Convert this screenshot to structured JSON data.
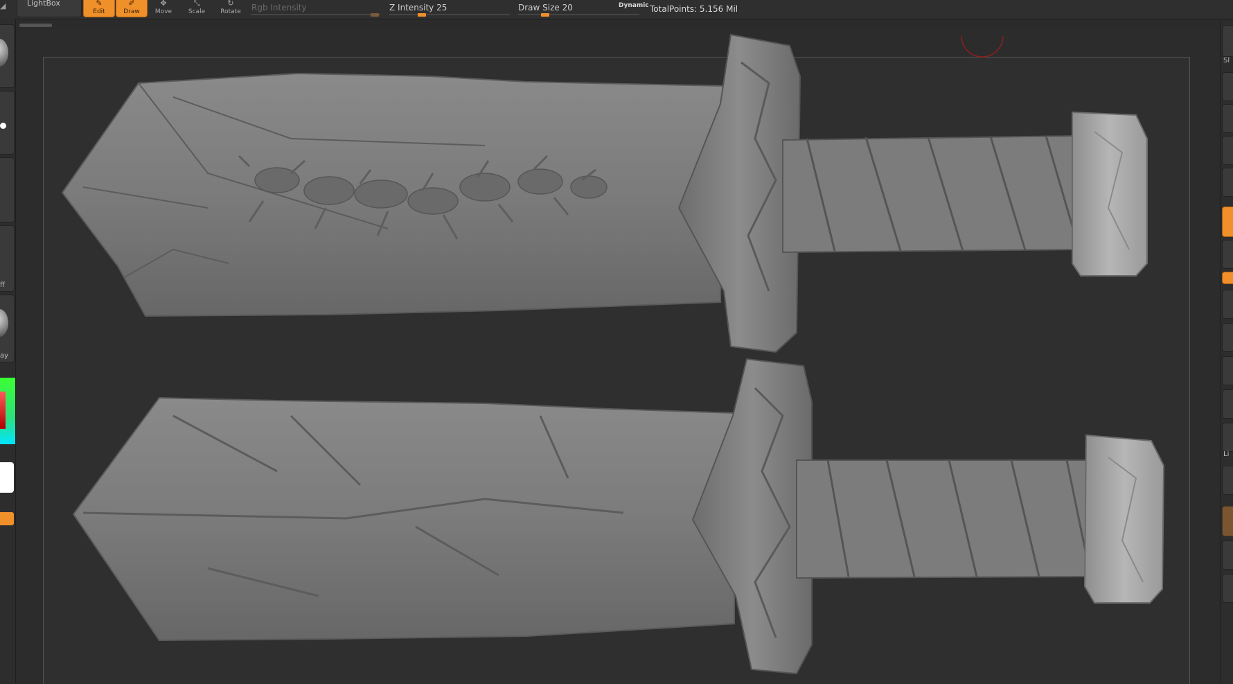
{
  "toolbar": {
    "lightbox_label": "LightBox",
    "modes": [
      {
        "label": "Edit",
        "icon": "edit-icon",
        "active": true
      },
      {
        "label": "Draw",
        "icon": "draw-icon",
        "active": true
      },
      {
        "label": "Move",
        "icon": "move-icon",
        "active": false
      },
      {
        "label": "Scale",
        "icon": "scale-icon",
        "active": false
      },
      {
        "label": "Rotate",
        "icon": "rotate-icon",
        "active": false
      }
    ],
    "rgb_intensity": {
      "label": "Rgb Intensity",
      "enabled": false
    },
    "z_intensity": {
      "label": "Z Intensity",
      "value": "25",
      "level": 0.25
    },
    "draw_size": {
      "label": "Draw Size",
      "value": "20",
      "level": 0.2
    },
    "dynamic_label": "Dynamic",
    "total_points": "TotalPoints: 5.156 Mil"
  },
  "left_shelf": {
    "fragments": [
      "ff",
      "ay"
    ],
    "primary_color": "#ffffff",
    "accent_color": "#f0902a"
  },
  "right_shelf": {
    "fragments": [
      "Sl",
      "Li"
    ]
  },
  "viewport": {
    "model": "two carved sword sculpts (front and back)",
    "mesh_color": "#7a7a7a",
    "background": "#2c2c2c"
  }
}
